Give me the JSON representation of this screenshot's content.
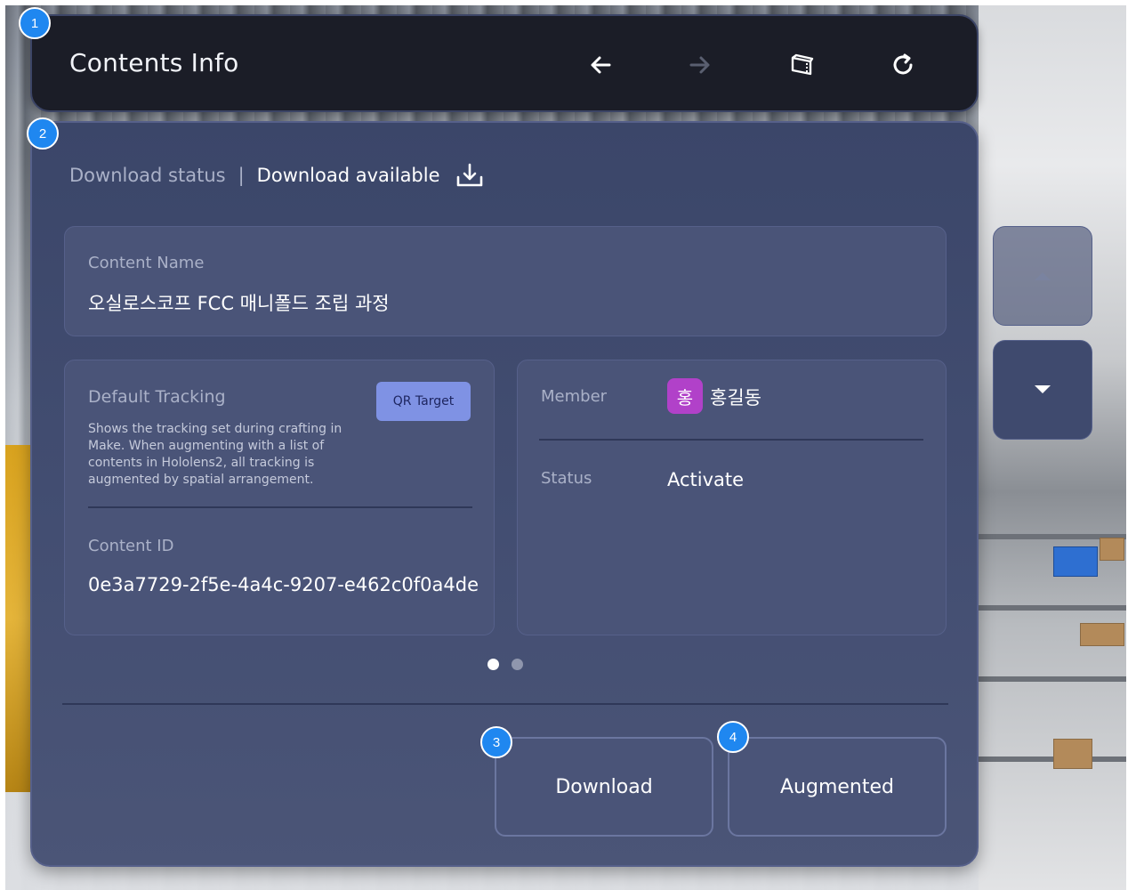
{
  "toolbar": {
    "title": "Contents Info",
    "buttons": [
      {
        "icon": "arrow-left-icon"
      },
      {
        "icon": "arrow-right-icon"
      },
      {
        "icon": "window-icon"
      },
      {
        "icon": "refresh-icon"
      }
    ]
  },
  "download_status": {
    "label": "Download status",
    "separator": "|",
    "value": "Download available",
    "icon": "download-icon"
  },
  "content_name": {
    "label": "Content Name",
    "value": "오실로스코프 FCC 매니폴드 조립 과정"
  },
  "tracking": {
    "label": "Default Tracking",
    "button_label": "QR Target",
    "description": "Shows the tracking set during crafting in Make. When augmenting with a list of contents in Hololens2, all tracking is augmented by spatial arrangement."
  },
  "content_id": {
    "label": "Content ID",
    "value": "0e3a7729-2f5e-4a4c-9207-e462c0f0a4de"
  },
  "member": {
    "label": "Member",
    "avatar_initial": "홍",
    "name": "홍길동",
    "avatar_color": "#b141c9"
  },
  "status": {
    "label": "Status",
    "value": "Activate"
  },
  "pager": {
    "pages": 2,
    "active": 1
  },
  "actions": {
    "download_label": "Download",
    "augmented_label": "Augmented"
  },
  "badges": [
    "1",
    "2",
    "3",
    "4"
  ],
  "colors": {
    "toolbar_bg": "#1b1d27",
    "panel_bg": "#434e72",
    "card_bg": "#4a5478",
    "accent_button": "#7f92e4",
    "badge": "#1f87f0"
  }
}
